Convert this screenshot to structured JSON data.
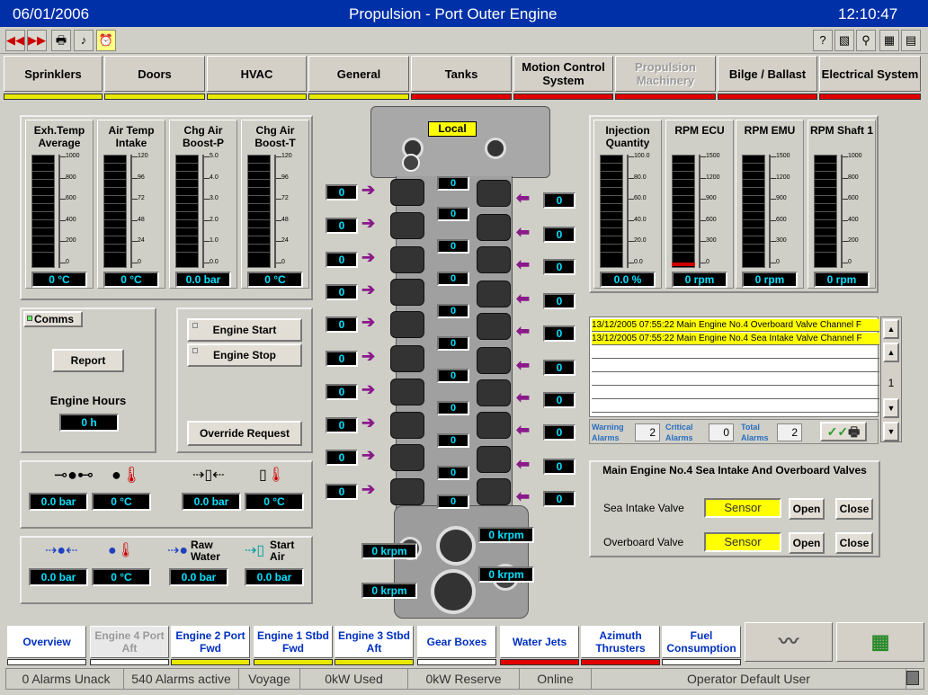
{
  "title": {
    "date": "06/01/2006",
    "name": "Propulsion - Port Outer Engine",
    "time": "12:10:47"
  },
  "top_nav": [
    {
      "label": "Sprinklers",
      "bar": "#e8e800"
    },
    {
      "label": "Doors",
      "bar": "#e8e800"
    },
    {
      "label": "HVAC",
      "bar": "#e8e800"
    },
    {
      "label": "General",
      "bar": "#e8e800"
    },
    {
      "label": "Tanks",
      "bar": "#e00000"
    },
    {
      "label": "Motion Control System",
      "bar": "#e00000"
    },
    {
      "label": "Propulsion Machinery",
      "bar": "#e00000"
    },
    {
      "label": "Bilge / Ballast",
      "bar": "#e00000"
    },
    {
      "label": "Electrical System",
      "bar": "#e00000"
    }
  ],
  "gauges_left": [
    {
      "label": "Exh.Temp Average",
      "value": "0 °C",
      "ticks": [
        "1000",
        "800",
        "600",
        "400",
        "200",
        "0"
      ]
    },
    {
      "label": "Air Temp Intake",
      "value": "0 °C",
      "ticks": [
        "120",
        "96",
        "72",
        "48",
        "24",
        "0"
      ]
    },
    {
      "label": "Chg Air Boost-P",
      "value": "0.0 bar",
      "ticks": [
        "5.0",
        "4.0",
        "3.0",
        "2.0",
        "1.0",
        "0.0"
      ]
    },
    {
      "label": "Chg Air Boost-T",
      "value": "0 °C",
      "ticks": [
        "120",
        "96",
        "72",
        "48",
        "24",
        "0"
      ]
    }
  ],
  "gauges_right": [
    {
      "label": "Injection Quantity",
      "value": "0.0 %",
      "ticks": [
        "100.0",
        "80.0",
        "60.0",
        "40.0",
        "20.0",
        "0.0"
      ]
    },
    {
      "label": "RPM ECU",
      "value": "0 rpm",
      "ticks": [
        "1500",
        "1200",
        "900",
        "600",
        "300",
        "0"
      ]
    },
    {
      "label": "RPM EMU",
      "value": "0 rpm",
      "ticks": [
        "1500",
        "1200",
        "900",
        "600",
        "300",
        "0"
      ]
    },
    {
      "label": "RPM Shaft 1",
      "value": "0 rpm",
      "ticks": [
        "1000",
        "800",
        "600",
        "400",
        "200",
        "0"
      ]
    }
  ],
  "controls": {
    "comms": "Comms",
    "report": "Report",
    "engine_hours_label": "Engine Hours",
    "engine_hours": "0 h",
    "engine_start": "Engine Start",
    "engine_stop": "Engine Stop",
    "override": "Override Request"
  },
  "engine": {
    "mode": "Local",
    "cyl_value": "0",
    "turbo": [
      "0 krpm",
      "0 krpm",
      "0 krpm",
      "0 krpm"
    ]
  },
  "readouts_row1": [
    "0.0 bar",
    "0 °C",
    "0.0 bar",
    "0 °C"
  ],
  "readouts_row2": [
    "0.0 bar",
    "0 °C",
    "0.0 bar",
    "0.0 bar"
  ],
  "row2_labels": {
    "raw_water": "Raw Water",
    "start_air": "Start Air"
  },
  "alarms": {
    "rows": [
      "13/12/2005 07:55:22 Main Engine No.4 Overboard Valve Channel F",
      "13/12/2005 07:55:22 Main Engine No.4 Sea Intake Valve Channel F"
    ],
    "page": "1",
    "warning_label": "Warning Alarms",
    "warning": "2",
    "critical_label": "Critical Alarms",
    "critical": "0",
    "total_label": "Total Alarms",
    "total": "2"
  },
  "valves": {
    "title": "Main Engine No.4 Sea Intake And Overboard Valves",
    "sea_label": "Sea Intake Valve",
    "over_label": "Overboard Valve",
    "sensor": "Sensor",
    "open": "Open",
    "close": "Close"
  },
  "bottom_nav": [
    {
      "label": "Overview",
      "bar": "#ffffff"
    },
    {
      "label": "Engine 4 Port Aft",
      "bar": "#ffffff"
    },
    {
      "label": "Engine 2 Port Fwd",
      "bar": "#e8e800"
    },
    {
      "label": "Engine 1 Stbd Fwd",
      "bar": "#e8e800"
    },
    {
      "label": "Engine 3 Stbd Aft",
      "bar": "#e8e800"
    },
    {
      "label": "Gear Boxes",
      "bar": "#ffffff"
    },
    {
      "label": "Water Jets",
      "bar": "#e00000"
    },
    {
      "label": "Azimuth Thrusters",
      "bar": "#e00000"
    },
    {
      "label": "Fuel Consumption",
      "bar": "#ffffff"
    }
  ],
  "status": [
    "0 Alarms Unack",
    "540 Alarms active",
    "Voyage",
    "0kW Used",
    "0kW Reserve",
    "Online",
    "Operator Default User"
  ]
}
